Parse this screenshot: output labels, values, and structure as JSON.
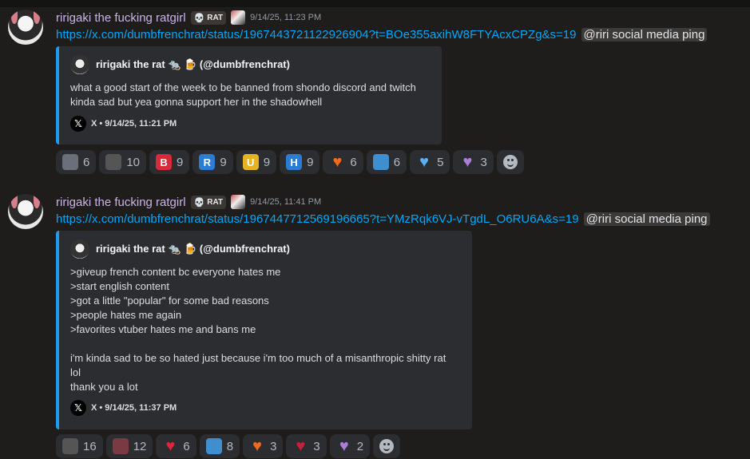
{
  "messages": [
    {
      "username": "ririgaki the fucking ratgirl",
      "tag": "RAT",
      "timestamp": "9/14/25, 11:23 PM",
      "link": "https://x.com/dumbfrenchrat/status/1967443721122926904?t=BOe355axihW8FTYAcxCPZg&s=19",
      "mention": "@riri social media ping",
      "embed": {
        "author": "ririgaki the rat 🐀 🍺 (@dumbfrenchrat)",
        "description": "what a good start of the week to be banned from shondo discord and twitch\nkinda sad but yea gonna support her in the shadowhell",
        "footer": "X • 9/14/25, 11:21 PM"
      },
      "reactions": [
        {
          "icon": "emote-icon",
          "label": "",
          "count": "6",
          "color": "#6a6f7a"
        },
        {
          "icon": "emote-icon",
          "label": "",
          "count": "10",
          "color": "#555"
        },
        {
          "icon": "letter-b-icon",
          "label": "B",
          "count": "9",
          "color": "#d92a3a"
        },
        {
          "icon": "letter-r-icon",
          "label": "R",
          "count": "9",
          "color": "#2b7cd3"
        },
        {
          "icon": "letter-u-icon",
          "label": "U",
          "count": "9",
          "color": "#e6b422"
        },
        {
          "icon": "letter-h-icon",
          "label": "H",
          "count": "9",
          "color": "#2b7cd3"
        },
        {
          "icon": "fire-heart-icon",
          "label": "♥",
          "count": "6",
          "color": "#ef6a1f"
        },
        {
          "icon": "hug-icon",
          "label": "",
          "count": "6",
          "color": "#3e8ed0"
        },
        {
          "icon": "blue-heart-icon",
          "label": "♥",
          "count": "5",
          "color": "#58b0f0"
        },
        {
          "icon": "purple-heart-icon",
          "label": "♥",
          "count": "3",
          "color": "#a97fd8"
        }
      ]
    },
    {
      "username": "ririgaki the fucking ratgirl",
      "tag": "RAT",
      "timestamp": "9/14/25, 11:41 PM",
      "link": "https://x.com/dumbfrenchrat/status/1967447712569196665?t=YMzRqk6VJ-vTgdL_O6RU6A&s=19",
      "mention": "@riri social media ping",
      "embed": {
        "author": "ririgaki the rat 🐀 🍺 (@dumbfrenchrat)",
        "description": ">giveup french content bc everyone hates me\n>start english content\n>got a little \"popular\" for some bad reasons\n>people hates me again\n>favorites vtuber hates me and bans me\n\ni'm kinda sad to be so hated just because i'm too much of a misanthropic shitty rat\nlol\nthank you a lot",
        "footer": "X • 9/14/25, 11:37 PM"
      },
      "reactions": [
        {
          "icon": "emote-icon",
          "label": "",
          "count": "16",
          "color": "#555"
        },
        {
          "icon": "emote-icon",
          "label": "",
          "count": "12",
          "color": "#7a3a44"
        },
        {
          "icon": "red-heart-icon",
          "label": "♥",
          "count": "6",
          "color": "#e0243a"
        },
        {
          "icon": "hug-icon",
          "label": "",
          "count": "8",
          "color": "#3e8ed0"
        },
        {
          "icon": "fire-heart-icon",
          "label": "♥",
          "count": "3",
          "color": "#ef6a1f"
        },
        {
          "icon": "anatomical-heart-icon",
          "label": "♥",
          "count": "3",
          "color": "#c2223a"
        },
        {
          "icon": "purple-heart-icon",
          "label": "♥",
          "count": "2",
          "color": "#a97fd8"
        }
      ]
    }
  ]
}
